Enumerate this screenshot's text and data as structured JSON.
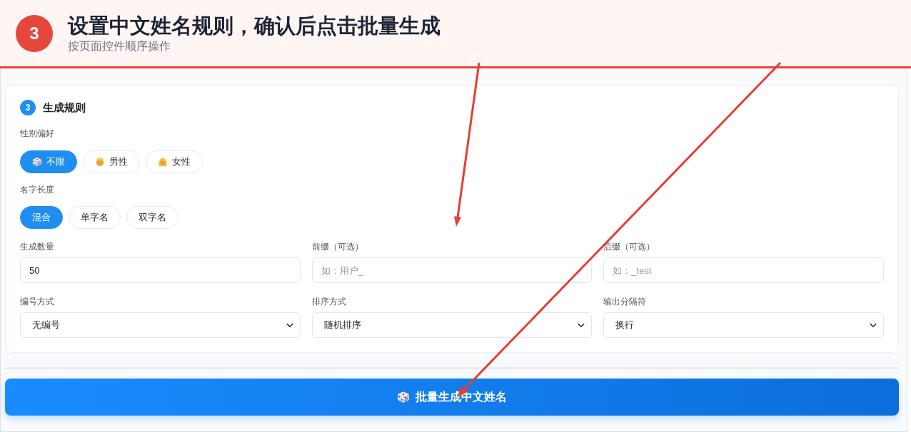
{
  "header": {
    "step": "3",
    "title": "设置中文姓名规则，确认后点击批量生成",
    "subtitle": "按页面控件顺序操作"
  },
  "rules": {
    "step": "3",
    "title": "生成规则",
    "gender": {
      "label": "性别偏好",
      "options": [
        {
          "kind": "any",
          "label": "不限",
          "selected": true
        },
        {
          "kind": "male",
          "label": "男性",
          "selected": false
        },
        {
          "kind": "female",
          "label": "女性",
          "selected": false
        }
      ]
    },
    "name_length": {
      "label": "名字长度",
      "options": [
        {
          "label": "混合",
          "selected": true
        },
        {
          "label": "单字名",
          "selected": false
        },
        {
          "label": "双字名",
          "selected": false
        }
      ]
    },
    "fields": [
      {
        "kind": "input",
        "label": "生成数量",
        "value": "50"
      },
      {
        "kind": "input",
        "label": "前缀（可选）",
        "placeholder": "如：用户_"
      },
      {
        "kind": "input",
        "label": "后缀（可选）",
        "placeholder": "如：_test"
      },
      {
        "kind": "select",
        "label": "编号方式",
        "value": "无编号"
      },
      {
        "kind": "select",
        "label": "排序方式",
        "value": "随机排序"
      },
      {
        "kind": "select",
        "label": "输出分隔符",
        "value": "换行"
      }
    ]
  },
  "generate_button": {
    "label": "批量生成中文姓名"
  }
}
